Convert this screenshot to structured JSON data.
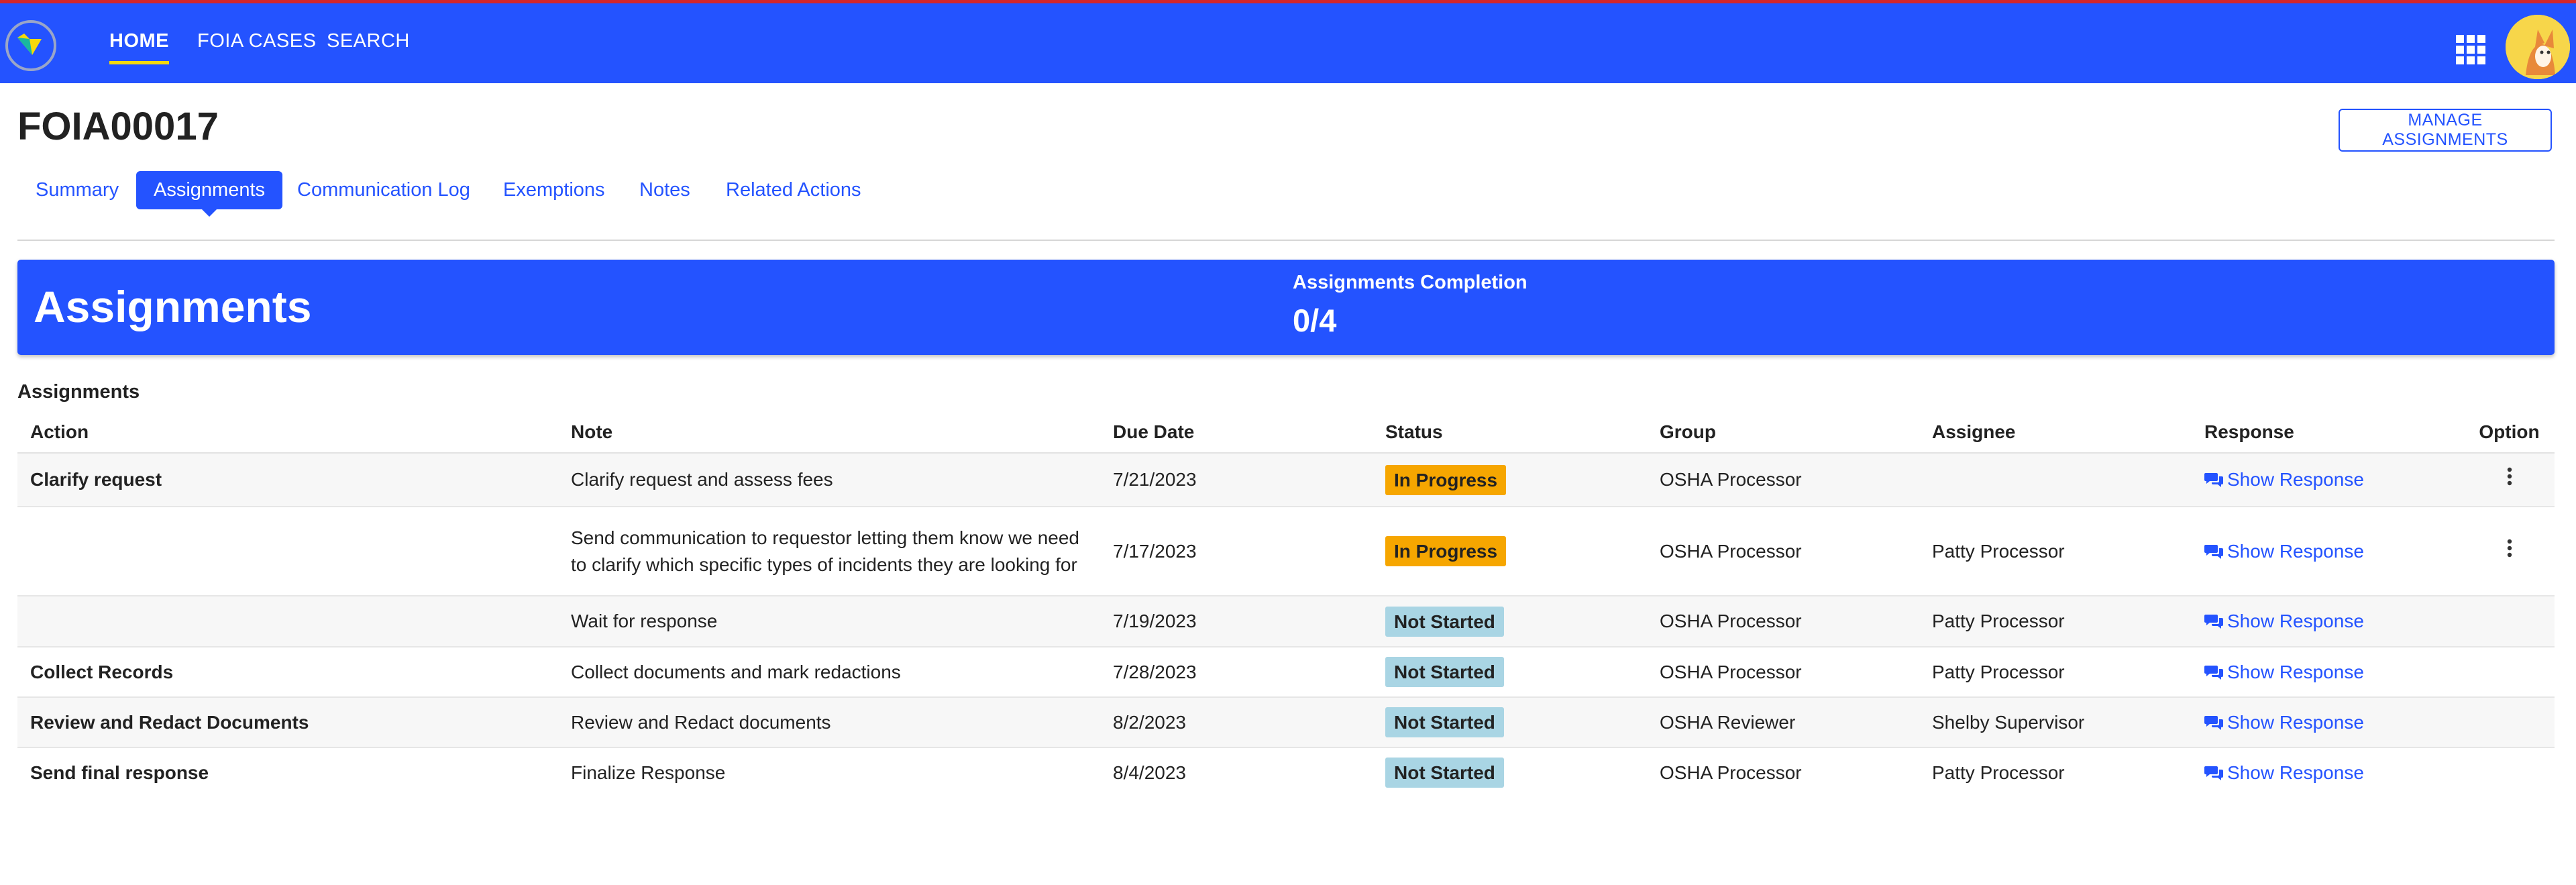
{
  "colors": {
    "brand": "#2453ff",
    "accent_underline": "#f5d90a",
    "top_stripe": "#d4262c",
    "in_progress": "#f6a600",
    "not_started": "#a9d5e4"
  },
  "nav": {
    "items": [
      {
        "label": "HOME",
        "active": true
      },
      {
        "label": "FOIA CASES",
        "active": false
      },
      {
        "label": "SEARCH",
        "active": false
      }
    ],
    "icons": [
      "app-logo-icon",
      "app-grid-icon",
      "user-avatar"
    ]
  },
  "page": {
    "title": "FOIA00017",
    "manage_button": "MANAGE ASSIGNMENTS"
  },
  "tabs": [
    {
      "label": "Summary",
      "active": false
    },
    {
      "label": "Assignments",
      "active": true
    },
    {
      "label": "Communication Log",
      "active": false
    },
    {
      "label": "Exemptions",
      "active": false
    },
    {
      "label": "Notes",
      "active": false
    },
    {
      "label": "Related Actions",
      "active": false
    }
  ],
  "banner": {
    "title": "Assignments",
    "completion_label": "Assignments Completion",
    "completion_value": "0/4"
  },
  "table": {
    "section_label": "Assignments",
    "columns": [
      "Action",
      "Note",
      "Due Date",
      "Status",
      "Group",
      "Assignee",
      "Response",
      "Option"
    ],
    "rows": [
      {
        "action": "Clarify request",
        "note": "Clarify request and assess fees",
        "due": "7/21/2023",
        "status": "In Progress",
        "group": "OSHA Processor",
        "assignee": "",
        "response": "Show Response",
        "has_option": true
      },
      {
        "action": "",
        "note": "Send communication to requestor letting them know we need to clarify which specific types of incidents they are looking for",
        "due": "7/17/2023",
        "status": "In Progress",
        "group": "OSHA Processor",
        "assignee": "Patty Processor",
        "response": "Show Response",
        "has_option": true
      },
      {
        "action": "",
        "note": "Wait for response",
        "due": "7/19/2023",
        "status": "Not Started",
        "group": "OSHA Processor",
        "assignee": "Patty Processor",
        "response": "Show Response",
        "has_option": false
      },
      {
        "action": "Collect Records",
        "note": "Collect documents and mark redactions",
        "due": "7/28/2023",
        "status": "Not Started",
        "group": "OSHA Processor",
        "assignee": "Patty Processor",
        "response": "Show Response",
        "has_option": false
      },
      {
        "action": "Review and Redact Documents",
        "note": "Review and Redact documents",
        "due": "8/2/2023",
        "status": "Not Started",
        "group": "OSHA Reviewer",
        "assignee": "Shelby Supervisor",
        "response": "Show Response",
        "has_option": false
      },
      {
        "action": "Send final response",
        "note": "Finalize Response",
        "due": "8/4/2023",
        "status": "Not Started",
        "group": "OSHA Processor",
        "assignee": "Patty Processor",
        "response": "Show Response",
        "has_option": false
      }
    ]
  }
}
